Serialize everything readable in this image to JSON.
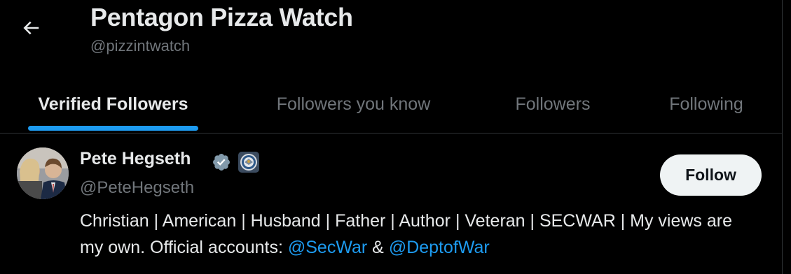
{
  "header": {
    "title": "Pentagon Pizza Watch",
    "handle": "@pizzintwatch",
    "back_icon": "arrow-left-icon"
  },
  "tabs": [
    {
      "label": "Verified Followers",
      "active": true
    },
    {
      "label": "Followers you know",
      "active": false
    },
    {
      "label": "Followers",
      "active": false
    },
    {
      "label": "Following",
      "active": false
    }
  ],
  "user": {
    "name": "Pete Hegseth",
    "handle": "@PeteHegseth",
    "verified_icon": "verified-badge-icon",
    "affiliate_icon": "dept-of-war-seal-icon",
    "follow_label": "Follow",
    "bio": {
      "text_before": "Christian | American | Husband | Father | Author | Veteran | SECWAR | My views are my own. Official accounts: ",
      "mention1": "@SecWar",
      "separator": " & ",
      "mention2": "@DeptofWar"
    }
  },
  "colors": {
    "background": "#000000",
    "primary_text": "#e7e9ea",
    "secondary_text": "#71767b",
    "accent": "#1d9bf0",
    "divider": "#2f3336",
    "follow_button_bg": "#eff3f4",
    "follow_button_text": "#0f1419"
  }
}
